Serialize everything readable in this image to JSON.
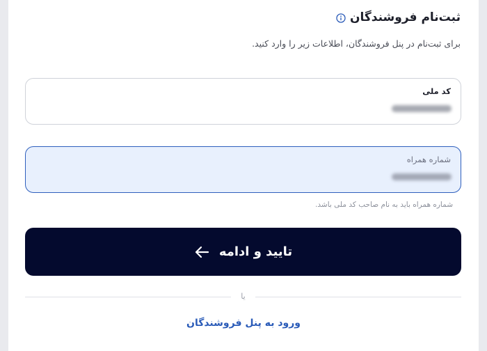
{
  "header": {
    "title": "ثبت‌نام فروشندگان",
    "subtitle": "برای ثبت‌نام در پنل فروشندگان، اطلاعات زیر را وارد کنید."
  },
  "form": {
    "national_code": {
      "label": "کد ملی",
      "state": "filled-redacted"
    },
    "phone": {
      "label": "شماره همراه",
      "state": "focused-filled-redacted",
      "hint": "شماره همراه باید به نام صاحب کد ملی باشد."
    },
    "submit_label": "تایید و ادامه"
  },
  "divider_text": "یا",
  "login_link": "ورود به پنل فروشندگان",
  "icons": {
    "info": "info-circle-icon",
    "arrow": "arrow-left-icon"
  },
  "colors": {
    "primary": "#040a2e",
    "link": "#2a5bb8",
    "focus_border": "#2e5fbd",
    "focus_background": "#e8f0fd"
  }
}
